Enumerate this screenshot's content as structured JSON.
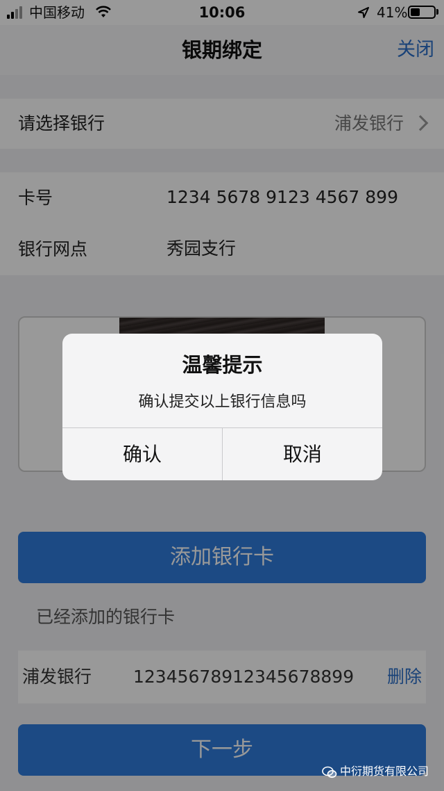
{
  "status_bar": {
    "carrier": "中国移动",
    "time": "10:06",
    "battery_percent": "41%",
    "battery_level": 0.41,
    "icons": [
      "signal-icon",
      "wifi-icon",
      "location-icon",
      "battery-icon"
    ]
  },
  "nav": {
    "title": "银期绑定",
    "close_label": "关闭"
  },
  "bank_select": {
    "label": "请选择银行",
    "value": "浦发银行"
  },
  "card_info": {
    "card_label": "卡号",
    "card_number": "1234 5678 9123 4567 899",
    "branch_label": "银行网点",
    "branch_value": "秀园支行"
  },
  "add_button_label": "添加银行卡",
  "added_section": {
    "title": "已经添加的银行卡",
    "cards": [
      {
        "bank": "浦发银行",
        "number": "12345678912345678899",
        "delete_label": "删除"
      }
    ]
  },
  "next_button_label": "下一步",
  "dialog": {
    "title": "温馨提示",
    "message": "确认提交以上银行信息吗",
    "confirm_label": "确认",
    "cancel_label": "取消"
  },
  "watermark": "中衍期货有限公司",
  "colors": {
    "accent": "#2b6ec8",
    "button_blue": "#2f7cdc"
  }
}
